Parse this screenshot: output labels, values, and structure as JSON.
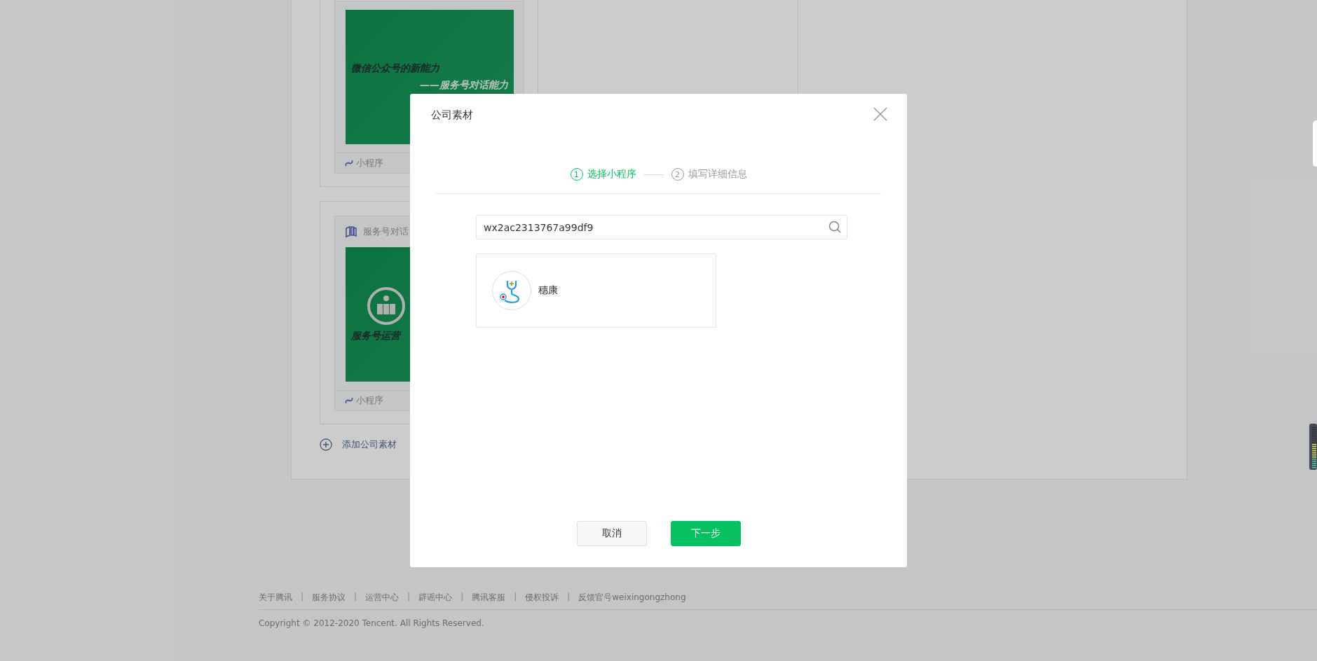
{
  "materials": [
    {
      "cover_lines": [
        "微信公众号的新能力",
        "——服务号对话能力"
      ],
      "kind": "quote",
      "type_label": "小程序"
    },
    {
      "title": "服务号对话",
      "cover_lines": [
        "服务号运营"
      ],
      "kind": "logo",
      "type_label": "小程序"
    }
  ],
  "add_material": "添加公司素材",
  "footer": {
    "items": [
      {
        "kind": "link",
        "text": "关于腾讯"
      },
      {
        "kind": "separator",
        "text": "|"
      },
      {
        "kind": "link",
        "text": "服务协议"
      },
      {
        "kind": "separator",
        "text": "|"
      },
      {
        "kind": "link",
        "text": "运营中心"
      },
      {
        "kind": "separator",
        "text": "|"
      },
      {
        "kind": "link",
        "text": "辟谣中心"
      },
      {
        "kind": "separator",
        "text": "|"
      },
      {
        "kind": "link",
        "text": "腾讯客服"
      },
      {
        "kind": "separator",
        "text": "|"
      },
      {
        "kind": "link",
        "text": "侵权投诉"
      },
      {
        "kind": "separator",
        "text": "|"
      },
      {
        "kind": "link",
        "text": "反馈官号weixingongzhong"
      }
    ],
    "copyright": "Copyright © 2012-2020 Tencent. All Rights Reserved."
  },
  "dialog": {
    "title": "公司素材",
    "steps": [
      {
        "number": "1",
        "label": "选择小程序",
        "selected": true
      },
      {
        "number": "2",
        "label": "填写详细信息",
        "selected": false
      }
    ],
    "search": {
      "value": "wx2ac2313767a99df9"
    },
    "results": [
      {
        "name": "穗康"
      }
    ],
    "buttons": [
      {
        "label": "取消",
        "kind": "secondary"
      },
      {
        "label": "下一步",
        "kind": "primary"
      }
    ]
  }
}
